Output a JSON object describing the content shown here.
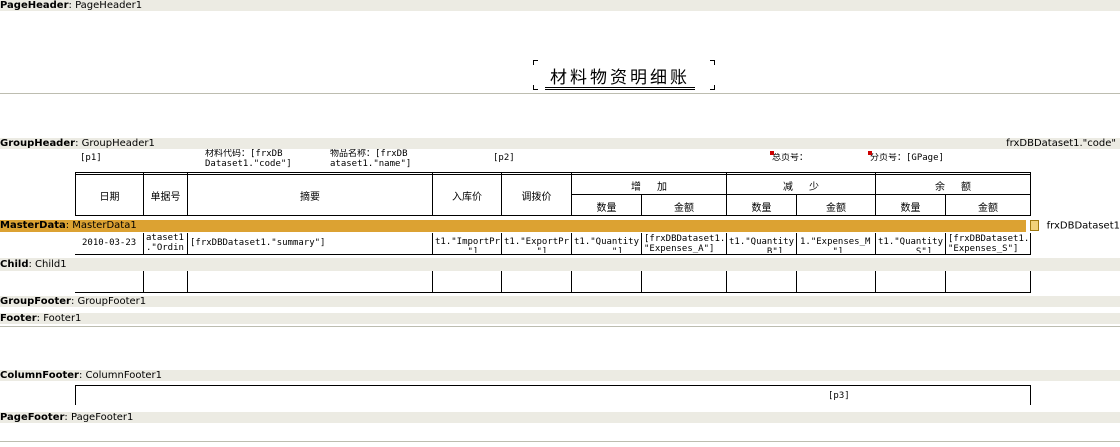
{
  "bands": {
    "page_header": {
      "kind": "PageHeader",
      "name": "PageHeader1"
    },
    "group_header": {
      "kind": "GroupHeader",
      "name": "GroupHeader1",
      "right": "frxDBDataset1.\"code\""
    },
    "master_data": {
      "kind": "MasterData",
      "name": "MasterData1",
      "right": "frxDBDataset1"
    },
    "child": {
      "kind": "Child",
      "name": "Child1"
    },
    "group_footer": {
      "kind": "GroupFooter",
      "name": "GroupFooter1"
    },
    "footer": {
      "kind": "Footer",
      "name": "Footer1"
    },
    "column_footer": {
      "kind": "ColumnFooter",
      "name": "ColumnFooter1"
    },
    "page_footer": {
      "kind": "PageFooter",
      "name": "PageFooter1"
    }
  },
  "title": "材料物资明细账",
  "group_header_fields": {
    "p1": "[p1]",
    "code": "材料代码：[frxDB\nDataset1.\"code\"]",
    "name": "物品名称：[frxDB\nataset1.\"name\"]",
    "p2": "[p2]",
    "total_pages": "总页号：",
    "page": "分页号：[GPage]"
  },
  "table_headers": {
    "date": "日期",
    "voucher": "单据号",
    "summary": "摘要",
    "import_price": "入库价",
    "export_price": "调拨价",
    "increase": "增     加",
    "decrease": "减     少",
    "balance": "余     额",
    "qty1": "数量",
    "amt1": "金额",
    "qty2": "数量",
    "amt2": "金额",
    "qty3": "数量",
    "amt3": "金额"
  },
  "master_fields": {
    "date": "2010-03-23",
    "voucher": "ataset1\n.\"Ordin",
    "summary": "[frxDBDataset1.\"summary\"]",
    "import_price": "t1.\"ImportPr\n      \"]",
    "export_price": "t1.\"ExportPr\n      \"]",
    "qty_a": "t1.\"Quantity\n       \"]",
    "exp_a": "[frxDBDataset1.\n\"Expenses_A\"]",
    "qty_b": "t1.\"Quantity\n       B\"]",
    "exp_b": "1.\"Expenses_M\n      \"]",
    "qty_s": "t1.\"Quantity\n       S\"]",
    "exp_s": "[frxDBDataset1.\n\"Expenses_S\"]"
  },
  "column_footer_field": "[p3]"
}
